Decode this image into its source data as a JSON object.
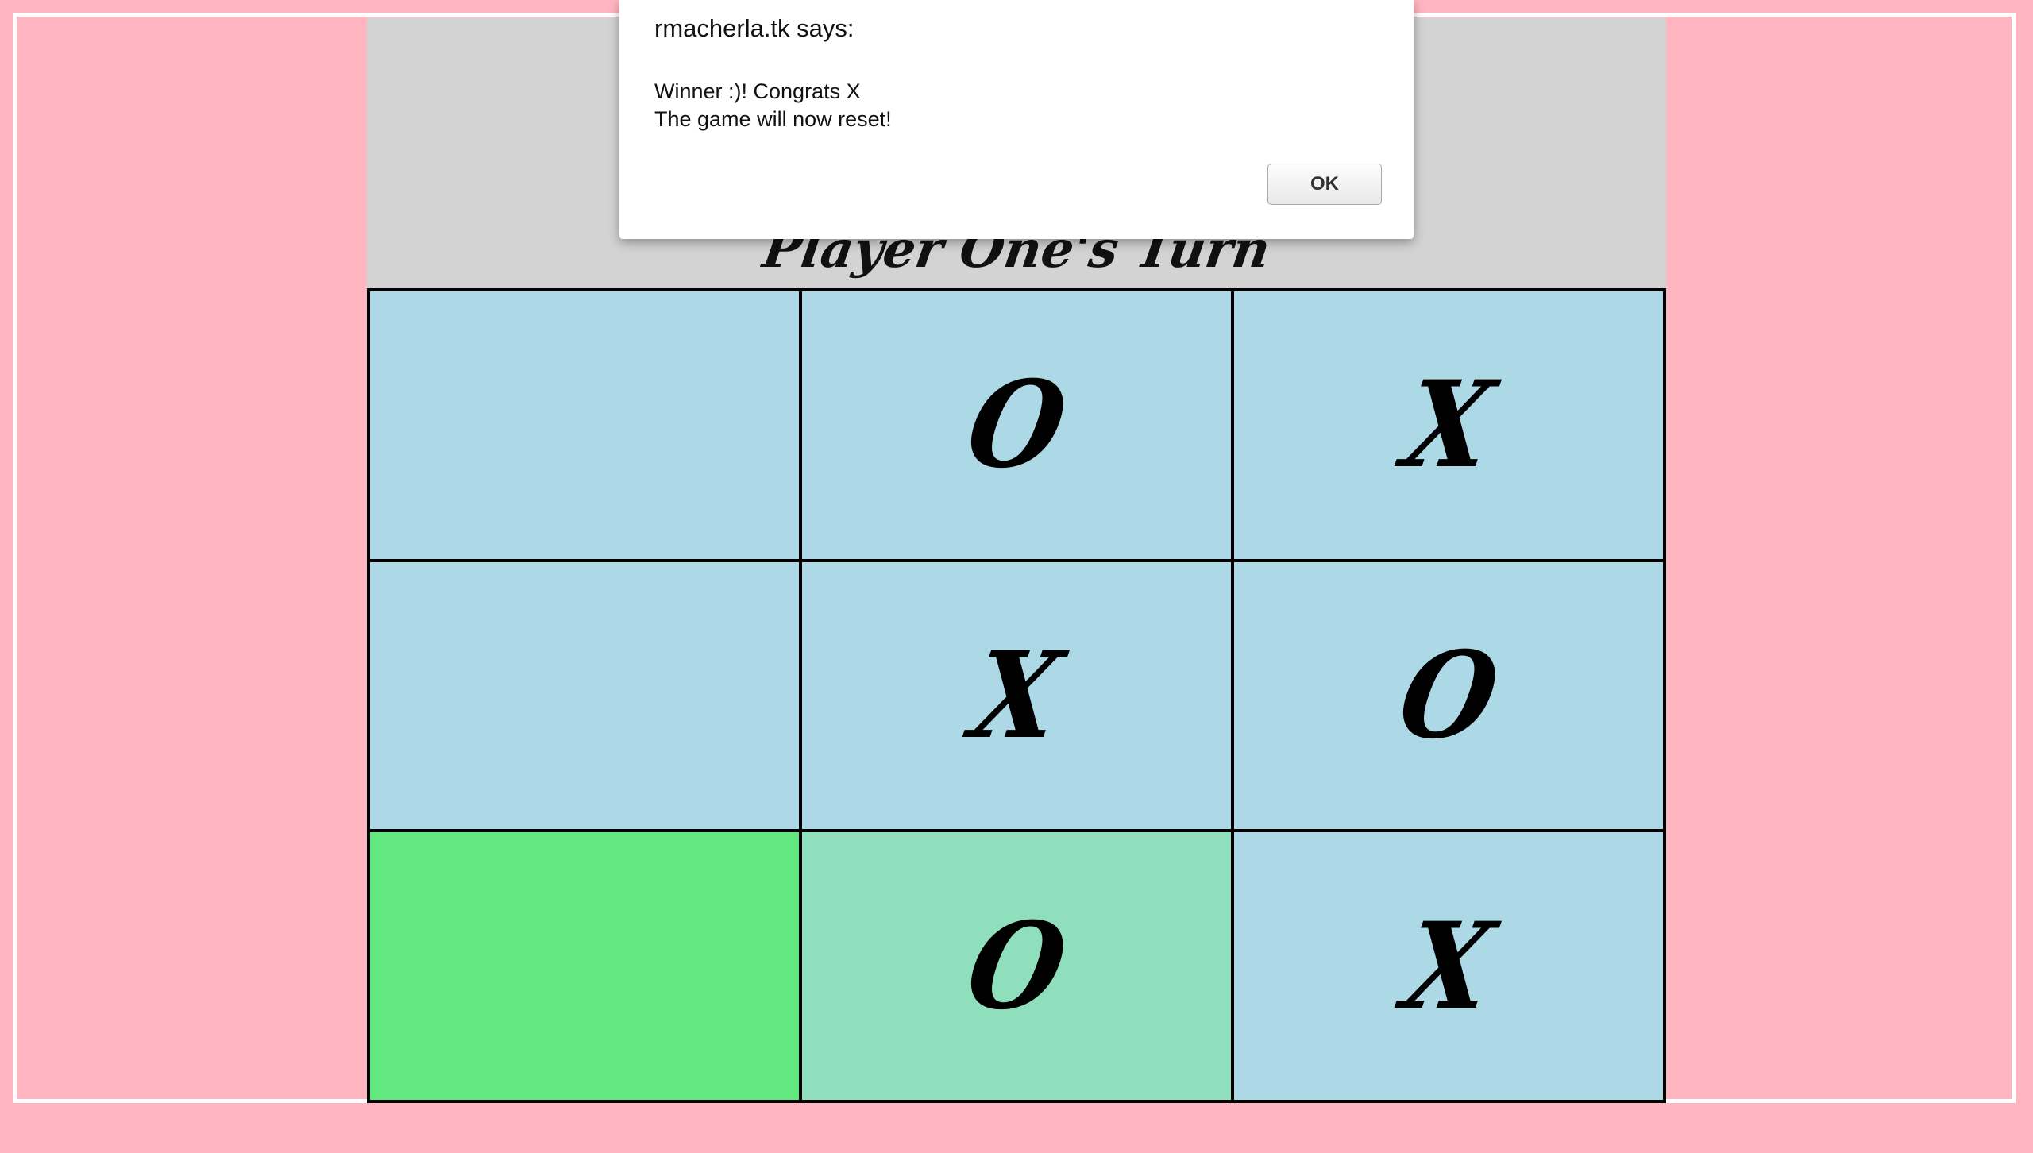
{
  "game": {
    "turn_label": "Player One's Turn",
    "board": [
      {
        "mark": "",
        "color": "#add8e6"
      },
      {
        "mark": "O",
        "color": "#add8e6"
      },
      {
        "mark": "X",
        "color": "#add8e6"
      },
      {
        "mark": "",
        "color": "#add8e6"
      },
      {
        "mark": "X",
        "color": "#add8e6"
      },
      {
        "mark": "O",
        "color": "#add8e6"
      },
      {
        "mark": "",
        "color": "#61e980"
      },
      {
        "mark": "O",
        "color": "#8fdfbd"
      },
      {
        "mark": "X",
        "color": "#add8e6"
      }
    ]
  },
  "dialog": {
    "title": "rmacherla.tk says:",
    "message_line1": "Winner :)! Congrats X",
    "message_line2": "The game will now reset!",
    "ok_label": "OK"
  },
  "colors": {
    "page_background": "#ffb6c1",
    "panel_background": "#d3d3d3",
    "cell_default": "#add8e6"
  }
}
